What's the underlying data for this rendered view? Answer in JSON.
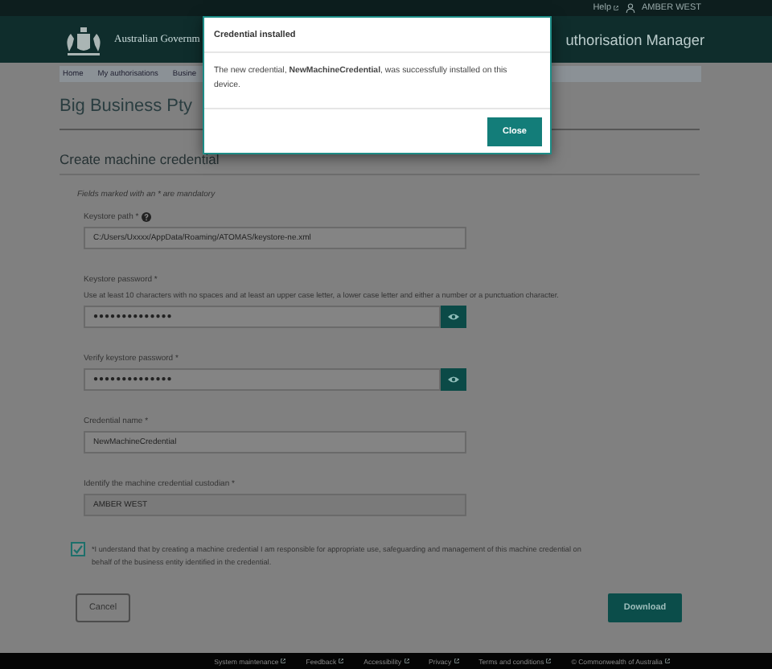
{
  "top_bar": {
    "help": "Help",
    "user": "AMBER WEST"
  },
  "header": {
    "government": "Australian Governm",
    "app_title": "uthorisation Manager"
  },
  "breadcrumbs": [
    "Home",
    "My authorisations",
    "Busine"
  ],
  "page_title": "Big Business Pty",
  "section_title": "Create machine credential",
  "mandatory_note": "Fields marked with an * are mandatory",
  "fields": [
    {
      "kind": "text",
      "label": "Keystore path *",
      "help_icon": true,
      "value": "C:/Users/Uxxxx/AppData/Roaming/ATOMAS/keystore-ne.xml"
    },
    {
      "kind": "password",
      "label": "Keystore password *",
      "hint": "Use at least 10 characters with no spaces and at least an upper case letter, a lower case letter and either a number or a punctuation character.",
      "value": "●●●●●●●●●●●●●●"
    },
    {
      "kind": "password",
      "label": "Verify keystore password *",
      "value": "●●●●●●●●●●●●●●"
    },
    {
      "kind": "text",
      "label": "Credential name *",
      "value": "NewMachineCredential"
    },
    {
      "kind": "readonly",
      "label": "Identify the machine credential custodian *",
      "value": "AMBER WEST"
    }
  ],
  "agreement": {
    "checked": true,
    "text": "*I understand that by creating a machine credential I am responsible for appropriate use, safeguarding and management of this machine credential on behalf of the business entity identified in the credential."
  },
  "buttons": {
    "cancel": "Cancel",
    "download": "Download"
  },
  "footer": [
    "System maintenance",
    "Feedback",
    "Accessibility",
    "Privacy",
    "Terms and conditions",
    "© Commonwealth of Australia"
  ],
  "dialog": {
    "title": "Credential installed",
    "message": "The new credential, **NewMachineCredential**, was successfully installed on this device.",
    "button": "Close"
  }
}
